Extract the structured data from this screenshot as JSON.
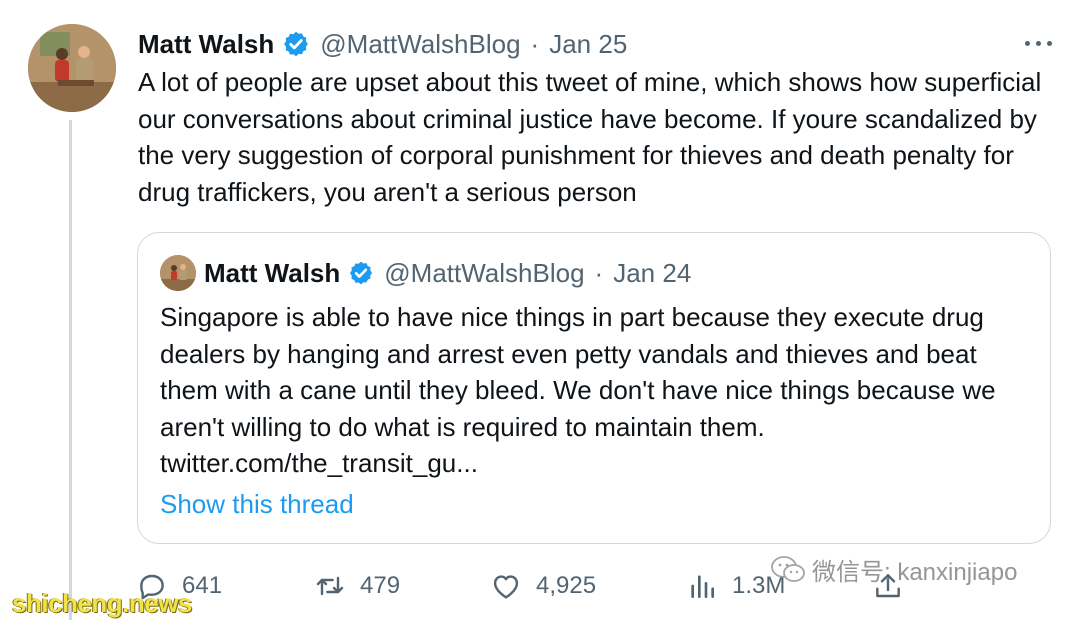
{
  "tweet": {
    "author_name": "Matt Walsh",
    "handle": "@MattWalshBlog",
    "separator": "·",
    "date": "Jan 25",
    "text": "A lot of people are upset about this tweet of mine, which shows how superficial our conversations about criminal justice have become. If youre scandalized by the very suggestion of corporal punishment for thieves and death penalty for drug traffickers, you aren't a serious person"
  },
  "quoted_tweet": {
    "author_name": "Matt Walsh",
    "handle": "@MattWalshBlog",
    "separator": "·",
    "date": "Jan 24",
    "text": "Singapore is able to have nice things in part because they execute drug dealers by hanging and arrest even petty vandals and thieves and beat them with a cane until they bleed. We don't have nice things because we aren't willing to do what is required to maintain them.",
    "link": "twitter.com/the_transit_gu...",
    "show_thread_label": "Show this thread"
  },
  "actions": {
    "replies": "641",
    "retweets": "479",
    "likes": "4,925",
    "views": "1.3M"
  },
  "watermarks": {
    "wechat": "微信号: kanxinjiapo",
    "site": "shicheng.news"
  },
  "colors": {
    "accent": "#1d9bf0",
    "secondary_text": "#536471",
    "border": "#cfd9de"
  },
  "icons": [
    "more-icon",
    "verified-badge-icon",
    "reply-icon",
    "retweet-icon",
    "like-icon",
    "views-icon",
    "share-icon",
    "wechat-icon"
  ]
}
